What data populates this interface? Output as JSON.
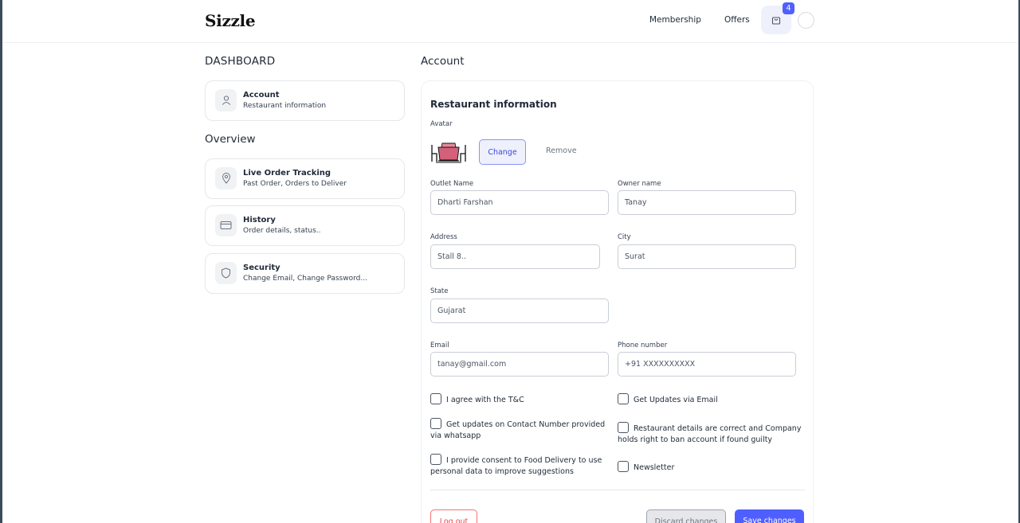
{
  "header": {
    "logo": "Sizzle",
    "nav": {
      "membership": "Membership",
      "offers": "Offers"
    },
    "cart_count": "4"
  },
  "sidebar": {
    "heading": "DASHBOARD",
    "account": {
      "title": "Account",
      "subtitle": "Restaurant information",
      "icon": "user-icon"
    },
    "overview_heading": "Overview",
    "items": [
      {
        "title": "Live Order Tracking",
        "subtitle": "Past Order, Orders to Deliver",
        "icon": "location-pin-icon"
      },
      {
        "title": "History",
        "subtitle": "Order details, status..",
        "icon": "card-icon"
      },
      {
        "title": "Security",
        "subtitle": "Change Email, Change Password...",
        "icon": "shield-icon"
      }
    ]
  },
  "main": {
    "heading": "Account",
    "section_title": "Restaurant information",
    "avatar_label": "Avatar",
    "change_label": "Change",
    "remove_label": "Remove",
    "fields": {
      "outlet_name": {
        "label": "Outlet Name",
        "value": "Dharti Farshan"
      },
      "owner_name": {
        "label": "Owner name",
        "value": "Tanay"
      },
      "address": {
        "label": "Address",
        "value": "Stall 8.."
      },
      "city": {
        "label": "City",
        "value": "Surat"
      },
      "state": {
        "label": "State",
        "value": "Gujarat"
      },
      "email": {
        "label": "Email",
        "value": "tanay@gmail.com"
      },
      "phone": {
        "label": "Phone number",
        "value": "+91 XXXXXXXXXX"
      }
    },
    "checkboxes": {
      "tnc": "I agree with the T&C",
      "email_updates": "Get Updates via Email",
      "whatsapp": "Get updates on Contact Number provided via whatsapp",
      "details_correct": "Restaurant details are correct and Company holds right to ban account if found guilty",
      "consent": "I provide consent to Food Delivery to use personal data to improve suggestions",
      "newsletter": "Newsletter"
    },
    "buttons": {
      "logout": "Log out",
      "discard": "Discard changes",
      "save": "Save changes"
    }
  }
}
